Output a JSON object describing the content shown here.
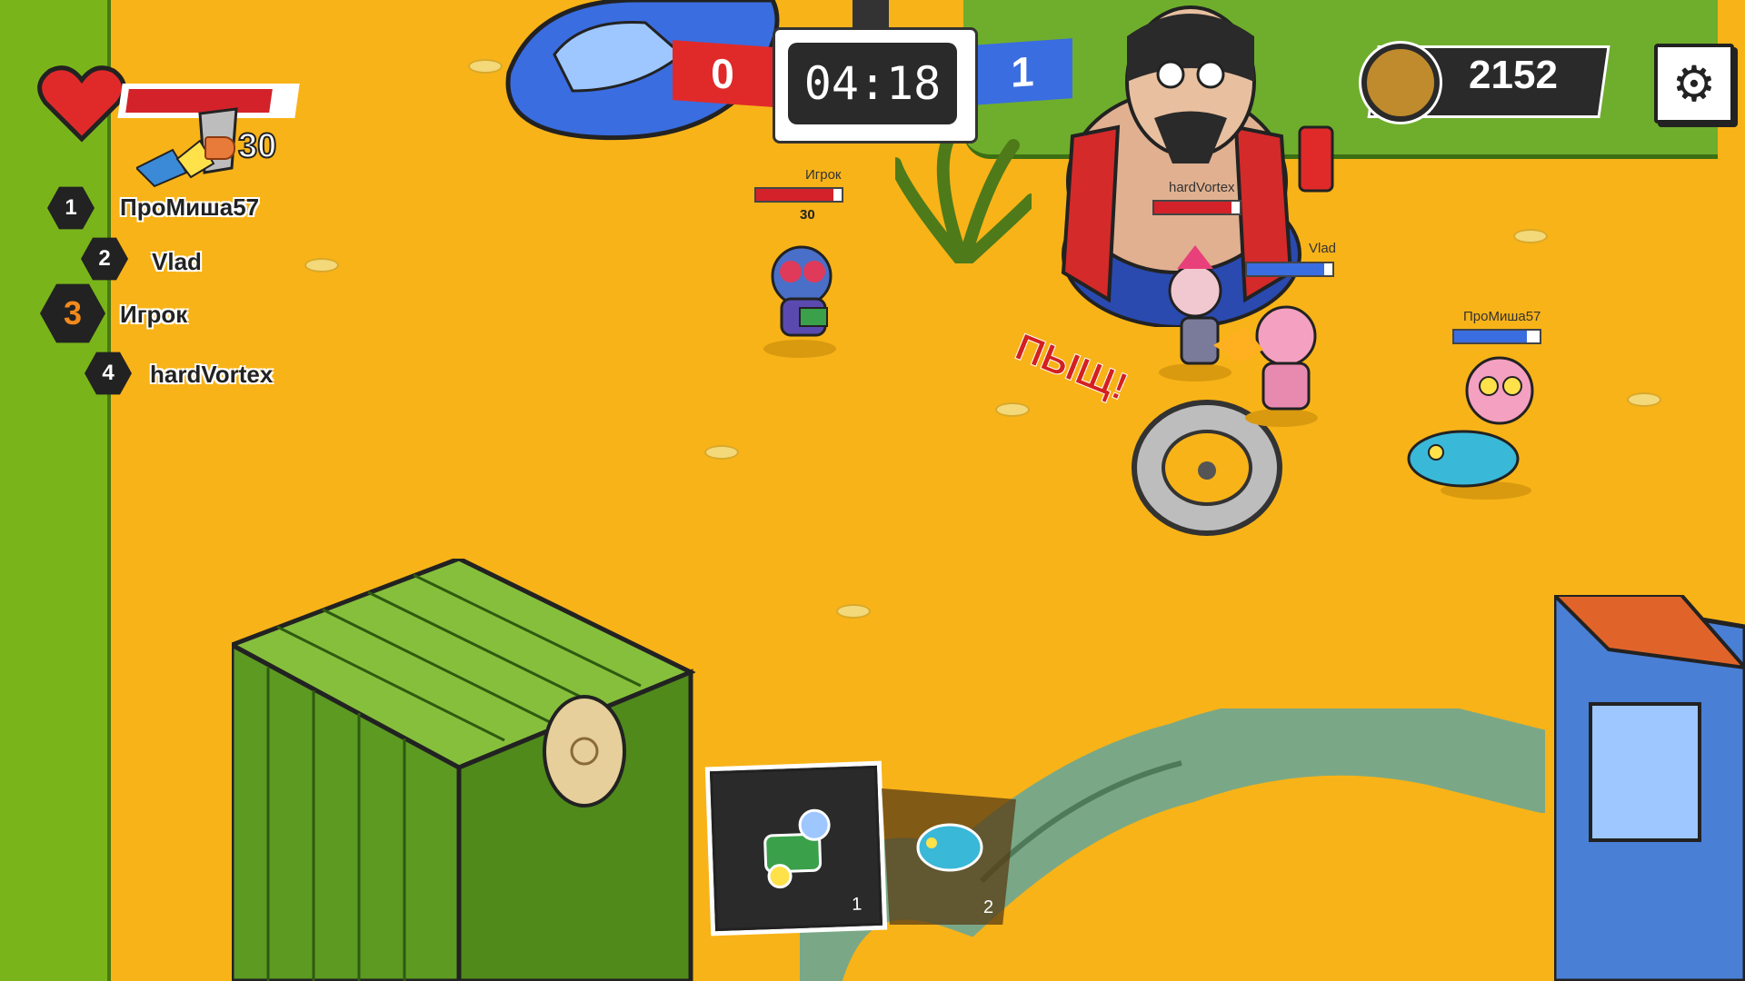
{
  "hud": {
    "ammo": "30",
    "health_fraction": 0.9,
    "leaderboard": [
      {
        "rank": "1",
        "name": "ПроМиша57"
      },
      {
        "rank": "2",
        "name": "Vlad"
      },
      {
        "rank": "3",
        "name": "Игрок"
      },
      {
        "rank": "4",
        "name": "hardVortex"
      }
    ]
  },
  "match": {
    "red_score": "0",
    "blue_score": "1",
    "timer": "04:18"
  },
  "coins": "2152",
  "players": {
    "player": {
      "name": "Игрок",
      "ammo": "30",
      "hp_fraction": 0.9
    },
    "hardvortex": {
      "name": "hardVortex",
      "hp_fraction": 0.9
    },
    "vlad": {
      "name": "Vlad",
      "hp_fraction": 0.9
    },
    "promisha": {
      "name": "ПроМиша57",
      "hp_fraction": 0.85
    }
  },
  "effects": {
    "sound_text": "ПЫЩ!"
  },
  "inventory": [
    {
      "slot": "1",
      "item": "flower-gun"
    },
    {
      "slot": "2",
      "item": "pufferfish"
    }
  ],
  "colors": {
    "ground": "#f8b318",
    "grass": "#79b51a",
    "red_team": "#e02a2a",
    "blue_team": "#3a6de0",
    "health": "#d4222a"
  }
}
